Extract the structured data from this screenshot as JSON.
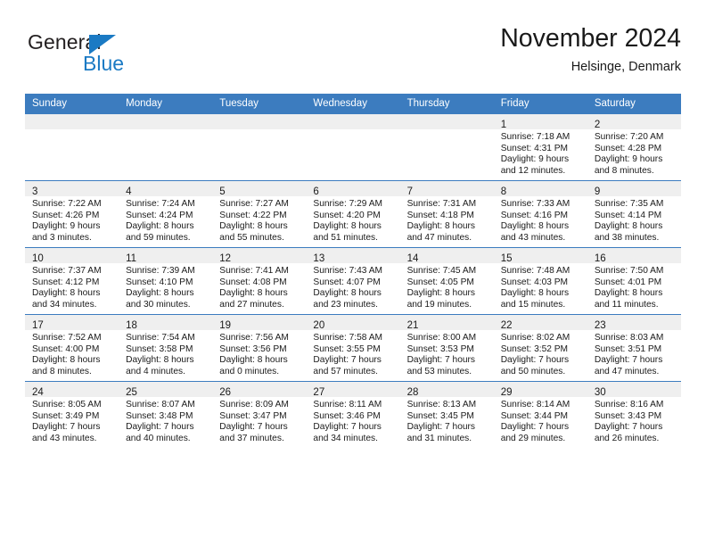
{
  "logo": {
    "word1": "General",
    "word2": "Blue",
    "triangle_color": "#1b7ac4",
    "word2_color": "#1b7ac4",
    "word1_color": "#231f20"
  },
  "header": {
    "title": "November 2024",
    "subtitle": "Helsinge, Denmark"
  },
  "theme": {
    "header_bg": "#3c7cbf",
    "header_text": "#ffffff",
    "daynum_band_bg": "#efefef",
    "cell_bg": "#ffffff",
    "row_divider": "#3c7cbf"
  },
  "weekday_headers": [
    "Sunday",
    "Monday",
    "Tuesday",
    "Wednesday",
    "Thursday",
    "Friday",
    "Saturday"
  ],
  "weeks": [
    [
      {
        "day": "",
        "sunrise": "",
        "sunset": "",
        "daylight1": "",
        "daylight2": "",
        "empty": true
      },
      {
        "day": "",
        "sunrise": "",
        "sunset": "",
        "daylight1": "",
        "daylight2": "",
        "empty": true
      },
      {
        "day": "",
        "sunrise": "",
        "sunset": "",
        "daylight1": "",
        "daylight2": "",
        "empty": true
      },
      {
        "day": "",
        "sunrise": "",
        "sunset": "",
        "daylight1": "",
        "daylight2": "",
        "empty": true
      },
      {
        "day": "",
        "sunrise": "",
        "sunset": "",
        "daylight1": "",
        "daylight2": "",
        "empty": true
      },
      {
        "day": "1",
        "sunrise": "Sunrise: 7:18 AM",
        "sunset": "Sunset: 4:31 PM",
        "daylight1": "Daylight: 9 hours",
        "daylight2": "and 12 minutes.",
        "empty": false
      },
      {
        "day": "2",
        "sunrise": "Sunrise: 7:20 AM",
        "sunset": "Sunset: 4:28 PM",
        "daylight1": "Daylight: 9 hours",
        "daylight2": "and 8 minutes.",
        "empty": false
      }
    ],
    [
      {
        "day": "3",
        "sunrise": "Sunrise: 7:22 AM",
        "sunset": "Sunset: 4:26 PM",
        "daylight1": "Daylight: 9 hours",
        "daylight2": "and 3 minutes.",
        "empty": false
      },
      {
        "day": "4",
        "sunrise": "Sunrise: 7:24 AM",
        "sunset": "Sunset: 4:24 PM",
        "daylight1": "Daylight: 8 hours",
        "daylight2": "and 59 minutes.",
        "empty": false
      },
      {
        "day": "5",
        "sunrise": "Sunrise: 7:27 AM",
        "sunset": "Sunset: 4:22 PM",
        "daylight1": "Daylight: 8 hours",
        "daylight2": "and 55 minutes.",
        "empty": false
      },
      {
        "day": "6",
        "sunrise": "Sunrise: 7:29 AM",
        "sunset": "Sunset: 4:20 PM",
        "daylight1": "Daylight: 8 hours",
        "daylight2": "and 51 minutes.",
        "empty": false
      },
      {
        "day": "7",
        "sunrise": "Sunrise: 7:31 AM",
        "sunset": "Sunset: 4:18 PM",
        "daylight1": "Daylight: 8 hours",
        "daylight2": "and 47 minutes.",
        "empty": false
      },
      {
        "day": "8",
        "sunrise": "Sunrise: 7:33 AM",
        "sunset": "Sunset: 4:16 PM",
        "daylight1": "Daylight: 8 hours",
        "daylight2": "and 43 minutes.",
        "empty": false
      },
      {
        "day": "9",
        "sunrise": "Sunrise: 7:35 AM",
        "sunset": "Sunset: 4:14 PM",
        "daylight1": "Daylight: 8 hours",
        "daylight2": "and 38 minutes.",
        "empty": false
      }
    ],
    [
      {
        "day": "10",
        "sunrise": "Sunrise: 7:37 AM",
        "sunset": "Sunset: 4:12 PM",
        "daylight1": "Daylight: 8 hours",
        "daylight2": "and 34 minutes.",
        "empty": false
      },
      {
        "day": "11",
        "sunrise": "Sunrise: 7:39 AM",
        "sunset": "Sunset: 4:10 PM",
        "daylight1": "Daylight: 8 hours",
        "daylight2": "and 30 minutes.",
        "empty": false
      },
      {
        "day": "12",
        "sunrise": "Sunrise: 7:41 AM",
        "sunset": "Sunset: 4:08 PM",
        "daylight1": "Daylight: 8 hours",
        "daylight2": "and 27 minutes.",
        "empty": false
      },
      {
        "day": "13",
        "sunrise": "Sunrise: 7:43 AM",
        "sunset": "Sunset: 4:07 PM",
        "daylight1": "Daylight: 8 hours",
        "daylight2": "and 23 minutes.",
        "empty": false
      },
      {
        "day": "14",
        "sunrise": "Sunrise: 7:45 AM",
        "sunset": "Sunset: 4:05 PM",
        "daylight1": "Daylight: 8 hours",
        "daylight2": "and 19 minutes.",
        "empty": false
      },
      {
        "day": "15",
        "sunrise": "Sunrise: 7:48 AM",
        "sunset": "Sunset: 4:03 PM",
        "daylight1": "Daylight: 8 hours",
        "daylight2": "and 15 minutes.",
        "empty": false
      },
      {
        "day": "16",
        "sunrise": "Sunrise: 7:50 AM",
        "sunset": "Sunset: 4:01 PM",
        "daylight1": "Daylight: 8 hours",
        "daylight2": "and 11 minutes.",
        "empty": false
      }
    ],
    [
      {
        "day": "17",
        "sunrise": "Sunrise: 7:52 AM",
        "sunset": "Sunset: 4:00 PM",
        "daylight1": "Daylight: 8 hours",
        "daylight2": "and 8 minutes.",
        "empty": false
      },
      {
        "day": "18",
        "sunrise": "Sunrise: 7:54 AM",
        "sunset": "Sunset: 3:58 PM",
        "daylight1": "Daylight: 8 hours",
        "daylight2": "and 4 minutes.",
        "empty": false
      },
      {
        "day": "19",
        "sunrise": "Sunrise: 7:56 AM",
        "sunset": "Sunset: 3:56 PM",
        "daylight1": "Daylight: 8 hours",
        "daylight2": "and 0 minutes.",
        "empty": false
      },
      {
        "day": "20",
        "sunrise": "Sunrise: 7:58 AM",
        "sunset": "Sunset: 3:55 PM",
        "daylight1": "Daylight: 7 hours",
        "daylight2": "and 57 minutes.",
        "empty": false
      },
      {
        "day": "21",
        "sunrise": "Sunrise: 8:00 AM",
        "sunset": "Sunset: 3:53 PM",
        "daylight1": "Daylight: 7 hours",
        "daylight2": "and 53 minutes.",
        "empty": false
      },
      {
        "day": "22",
        "sunrise": "Sunrise: 8:02 AM",
        "sunset": "Sunset: 3:52 PM",
        "daylight1": "Daylight: 7 hours",
        "daylight2": "and 50 minutes.",
        "empty": false
      },
      {
        "day": "23",
        "sunrise": "Sunrise: 8:03 AM",
        "sunset": "Sunset: 3:51 PM",
        "daylight1": "Daylight: 7 hours",
        "daylight2": "and 47 minutes.",
        "empty": false
      }
    ],
    [
      {
        "day": "24",
        "sunrise": "Sunrise: 8:05 AM",
        "sunset": "Sunset: 3:49 PM",
        "daylight1": "Daylight: 7 hours",
        "daylight2": "and 43 minutes.",
        "empty": false
      },
      {
        "day": "25",
        "sunrise": "Sunrise: 8:07 AM",
        "sunset": "Sunset: 3:48 PM",
        "daylight1": "Daylight: 7 hours",
        "daylight2": "and 40 minutes.",
        "empty": false
      },
      {
        "day": "26",
        "sunrise": "Sunrise: 8:09 AM",
        "sunset": "Sunset: 3:47 PM",
        "daylight1": "Daylight: 7 hours",
        "daylight2": "and 37 minutes.",
        "empty": false
      },
      {
        "day": "27",
        "sunrise": "Sunrise: 8:11 AM",
        "sunset": "Sunset: 3:46 PM",
        "daylight1": "Daylight: 7 hours",
        "daylight2": "and 34 minutes.",
        "empty": false
      },
      {
        "day": "28",
        "sunrise": "Sunrise: 8:13 AM",
        "sunset": "Sunset: 3:45 PM",
        "daylight1": "Daylight: 7 hours",
        "daylight2": "and 31 minutes.",
        "empty": false
      },
      {
        "day": "29",
        "sunrise": "Sunrise: 8:14 AM",
        "sunset": "Sunset: 3:44 PM",
        "daylight1": "Daylight: 7 hours",
        "daylight2": "and 29 minutes.",
        "empty": false
      },
      {
        "day": "30",
        "sunrise": "Sunrise: 8:16 AM",
        "sunset": "Sunset: 3:43 PM",
        "daylight1": "Daylight: 7 hours",
        "daylight2": "and 26 minutes.",
        "empty": false
      }
    ]
  ]
}
